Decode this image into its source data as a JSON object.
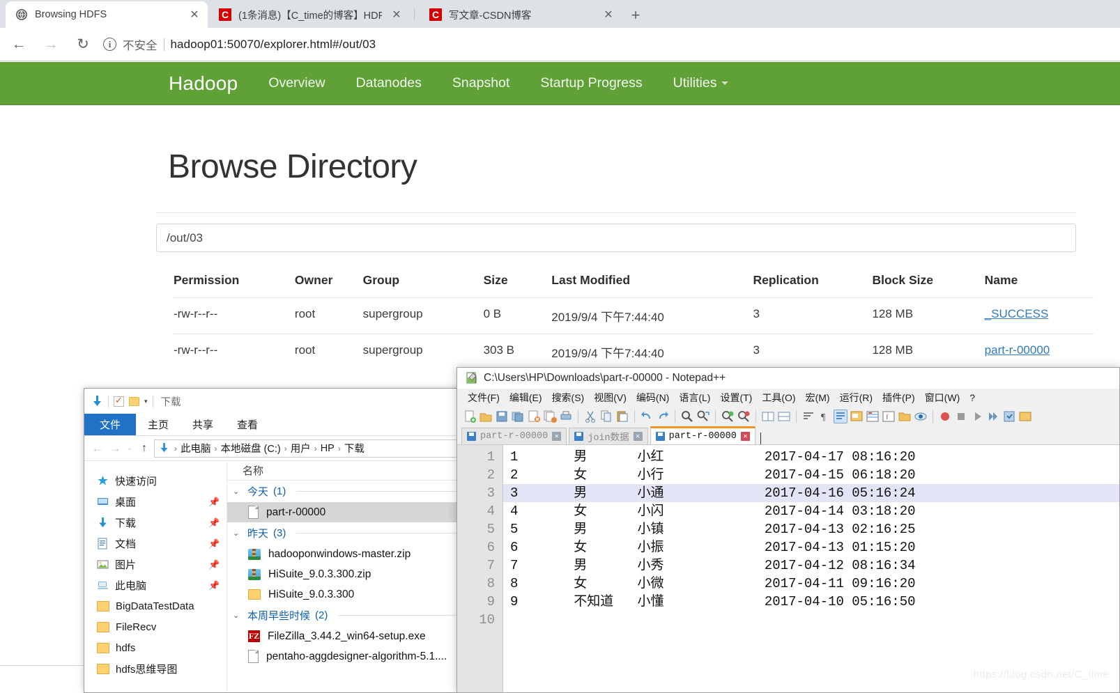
{
  "browser": {
    "tabs": [
      {
        "title": "Browsing HDFS",
        "favicon": "globe-icon",
        "active": true,
        "close_label": "✕"
      },
      {
        "title": "(1条消息)【C_time的博客】HDF",
        "favicon": "csdn-icon",
        "active": false,
        "close_label": "✕"
      },
      {
        "title": "写文章-CSDN博客",
        "favicon": "csdn-icon",
        "active": false,
        "close_label": "✕"
      }
    ],
    "newtab_label": "+",
    "back_label": "←",
    "forward_label": "→",
    "reload_label": "↻",
    "info_label": "i",
    "security_text": "不安全",
    "url": "hadoop01:50070/explorer.html#/out/03"
  },
  "hadoop": {
    "brand": "Hadoop",
    "nav_items": [
      "Overview",
      "Datanodes",
      "Snapshot",
      "Startup Progress"
    ],
    "utilities_label": "Utilities",
    "page_title": "Browse Directory",
    "path_value": "/out/03",
    "nav_bg": "#5fa137",
    "link_color": "#337ab7",
    "table": {
      "headers": [
        "Permission",
        "Owner",
        "Group",
        "Size",
        "Last Modified",
        "Replication",
        "Block Size",
        "Name"
      ],
      "rows": [
        {
          "permission": "-rw-r--r--",
          "owner": "root",
          "group": "supergroup",
          "size": "0 B",
          "modified": "2019/9/4 下午7:44:40",
          "replication": "3",
          "block_size": "128 MB",
          "name": "_SUCCESS"
        },
        {
          "permission": "-rw-r--r--",
          "owner": "root",
          "group": "supergroup",
          "size": "303 B",
          "modified": "2019/9/4 下午7:44:40",
          "replication": "3",
          "block_size": "128 MB",
          "name": "part-r-00000"
        }
      ]
    }
  },
  "explorer": {
    "window_title": "下载",
    "quick_access_icons": [
      "download-arrow-icon",
      "properties-check-icon",
      "new-folder-icon",
      "customize-dropdown-icon"
    ],
    "ribbon_tabs": [
      "文件",
      "主页",
      "共享",
      "查看"
    ],
    "nav": {
      "back": "←",
      "forward": "→",
      "recent": "⌄",
      "up": "↑"
    },
    "breadcrumb": [
      "此电脑",
      "本地磁盘 (C:)",
      "用户",
      "HP",
      "下载"
    ],
    "sidebar": [
      {
        "label": "快速访问",
        "icon": "star-icon",
        "pinned": false
      },
      {
        "label": "桌面",
        "icon": "desktop-icon",
        "pinned": true
      },
      {
        "label": "下载",
        "icon": "download-icon",
        "pinned": true
      },
      {
        "label": "文档",
        "icon": "documents-icon",
        "pinned": true
      },
      {
        "label": "图片",
        "icon": "pictures-icon",
        "pinned": true
      },
      {
        "label": "此电脑",
        "icon": "computer-icon",
        "pinned": true
      },
      {
        "label": "BigDataTestData",
        "icon": "folder-icon",
        "pinned": false
      },
      {
        "label": "FileRecv",
        "icon": "folder-icon",
        "pinned": false
      },
      {
        "label": "hdfs",
        "icon": "folder-icon",
        "pinned": false
      },
      {
        "label": "hdfs思维导图",
        "icon": "folder-icon",
        "pinned": false
      }
    ],
    "column_header": "名称",
    "groups": [
      {
        "label": "今天",
        "count": "(1)",
        "files": [
          {
            "name": "part-r-00000",
            "icon": "text-file-icon",
            "selected": true
          }
        ]
      },
      {
        "label": "昨天",
        "count": "(3)",
        "files": [
          {
            "name": "hadooponwindows-master.zip",
            "icon": "zip-icon",
            "selected": false
          },
          {
            "name": "HiSuite_9.0.3.300.zip",
            "icon": "zip-icon",
            "selected": false
          },
          {
            "name": "HiSuite_9.0.3.300",
            "icon": "folder-icon",
            "selected": false
          }
        ]
      },
      {
        "label": "本周早些时候",
        "count": "(2)",
        "files": [
          {
            "name": "FileZilla_3.44.2_win64-setup.exe",
            "icon": "filezilla-icon",
            "selected": false
          },
          {
            "name": "pentaho-aggdesigner-algorithm-5.1....",
            "icon": "text-file-icon",
            "selected": false
          }
        ]
      }
    ]
  },
  "notepadpp": {
    "title": "C:\\Users\\HP\\Downloads\\part-r-00000 - Notepad++",
    "menu": [
      "文件(F)",
      "编辑(E)",
      "搜索(S)",
      "视图(V)",
      "编码(N)",
      "语言(L)",
      "设置(T)",
      "工具(O)",
      "宏(M)",
      "运行(R)",
      "插件(P)",
      "窗口(W)",
      "?"
    ],
    "tabs": [
      {
        "label": "part-r-00000",
        "active": false,
        "close": "✕"
      },
      {
        "label": "join数据",
        "active": false,
        "close": "✕"
      },
      {
        "label": "part-r-00000",
        "active": true,
        "close": "✕"
      }
    ],
    "active_tab_accent": "#ef9421",
    "highlight_line": 3,
    "lines": [
      {
        "n": "1",
        "text": "1\t男\t小红\t\t2017-04-17 08:16:20"
      },
      {
        "n": "2",
        "text": "2\t女\t小行\t\t2017-04-15 06:18:20"
      },
      {
        "n": "3",
        "text": "3\t男\t小通\t\t2017-04-16 05:16:24"
      },
      {
        "n": "4",
        "text": "4\t女\t小闪\t\t2017-04-14 03:18:20"
      },
      {
        "n": "5",
        "text": "5\t男\t小镇\t\t2017-04-13 02:16:25"
      },
      {
        "n": "6",
        "text": "6\t女\t小振\t\t2017-04-13 01:15:20"
      },
      {
        "n": "7",
        "text": "7\t男\t小秀\t\t2017-04-12 08:16:34"
      },
      {
        "n": "8",
        "text": "8\t女\t小微\t\t2017-04-11 09:16:20"
      },
      {
        "n": "9",
        "text": "9\t不知道\t小懂\t\t2017-04-10 05:16:50"
      },
      {
        "n": "10",
        "text": ""
      }
    ]
  },
  "watermark": "https://blog.csdn.net/C_time"
}
